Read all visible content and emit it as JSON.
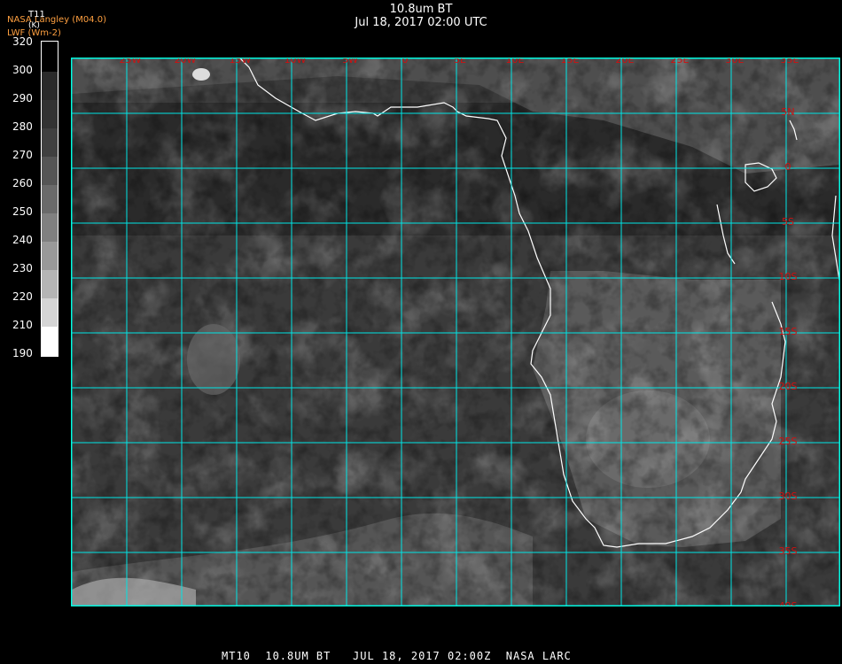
{
  "title": {
    "product": "10.8um BT",
    "datetime": "Jul 18, 2017 02:00 UTC"
  },
  "source": {
    "line1": "NASA Langley (M04.0)",
    "line2": "LWF (Wm-2)"
  },
  "colorbar": {
    "variable": "T11",
    "unit": "(K)",
    "labels": [
      "320",
      "300",
      "290",
      "280",
      "270",
      "260",
      "250",
      "240",
      "230",
      "220",
      "210",
      "190"
    ]
  },
  "map": {
    "lon_labels": [
      "25W",
      "20W",
      "15W",
      "10W",
      "5W",
      "0",
      "5E",
      "10E",
      "15E",
      "20E",
      "25E",
      "30E",
      "35E"
    ],
    "lat_labels": [
      "5N",
      "0",
      "5S",
      "10S",
      "15S",
      "20S",
      "25S",
      "30S",
      "35S",
      "40S"
    ],
    "grid_color": "#00e5e5",
    "label_color": "#d01010",
    "coast_color": "#ffffff"
  },
  "footer": {
    "text": "MT10  10.8UM BT   JUL 18, 2017 02:00Z  NASA LARC"
  }
}
